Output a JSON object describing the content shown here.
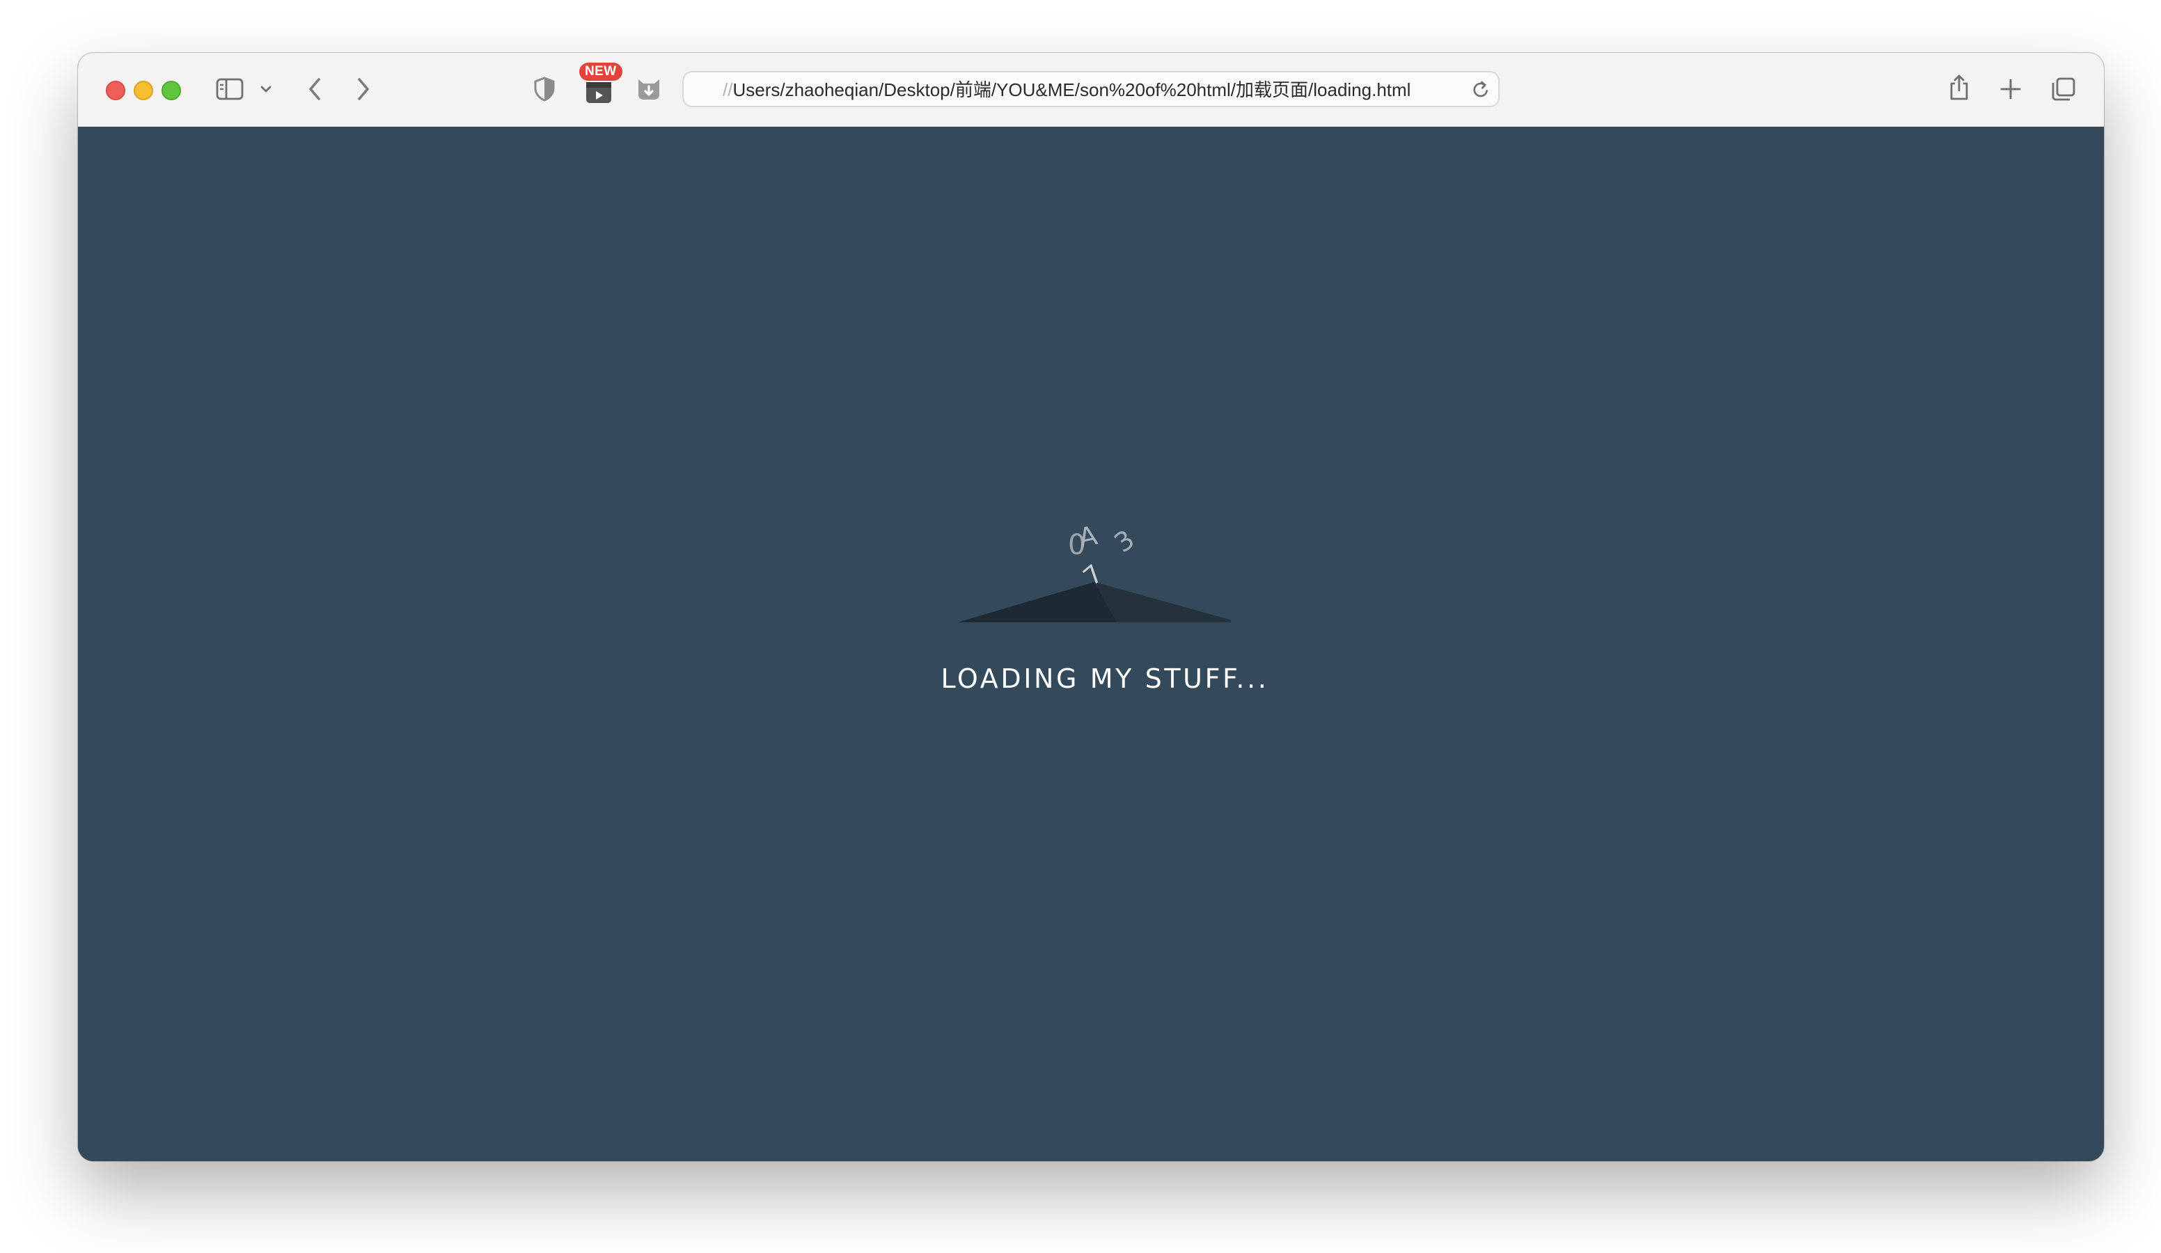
{
  "browser": {
    "new_badge": "NEW",
    "url_prefix": "//",
    "url": "Users/zhaoheqian/Desktop/前端/YOU&ME/son%20of%20html/加载页面/loading.html"
  },
  "loader": {
    "digits": [
      "0",
      "A",
      "3",
      "7"
    ],
    "label": "LOADING MY STUFF..."
  },
  "colors": {
    "page_background": "#34495a",
    "toolbar_background": "#f5f2f2",
    "mound_dark": "#1e2a33",
    "mound_light": "#233039"
  }
}
